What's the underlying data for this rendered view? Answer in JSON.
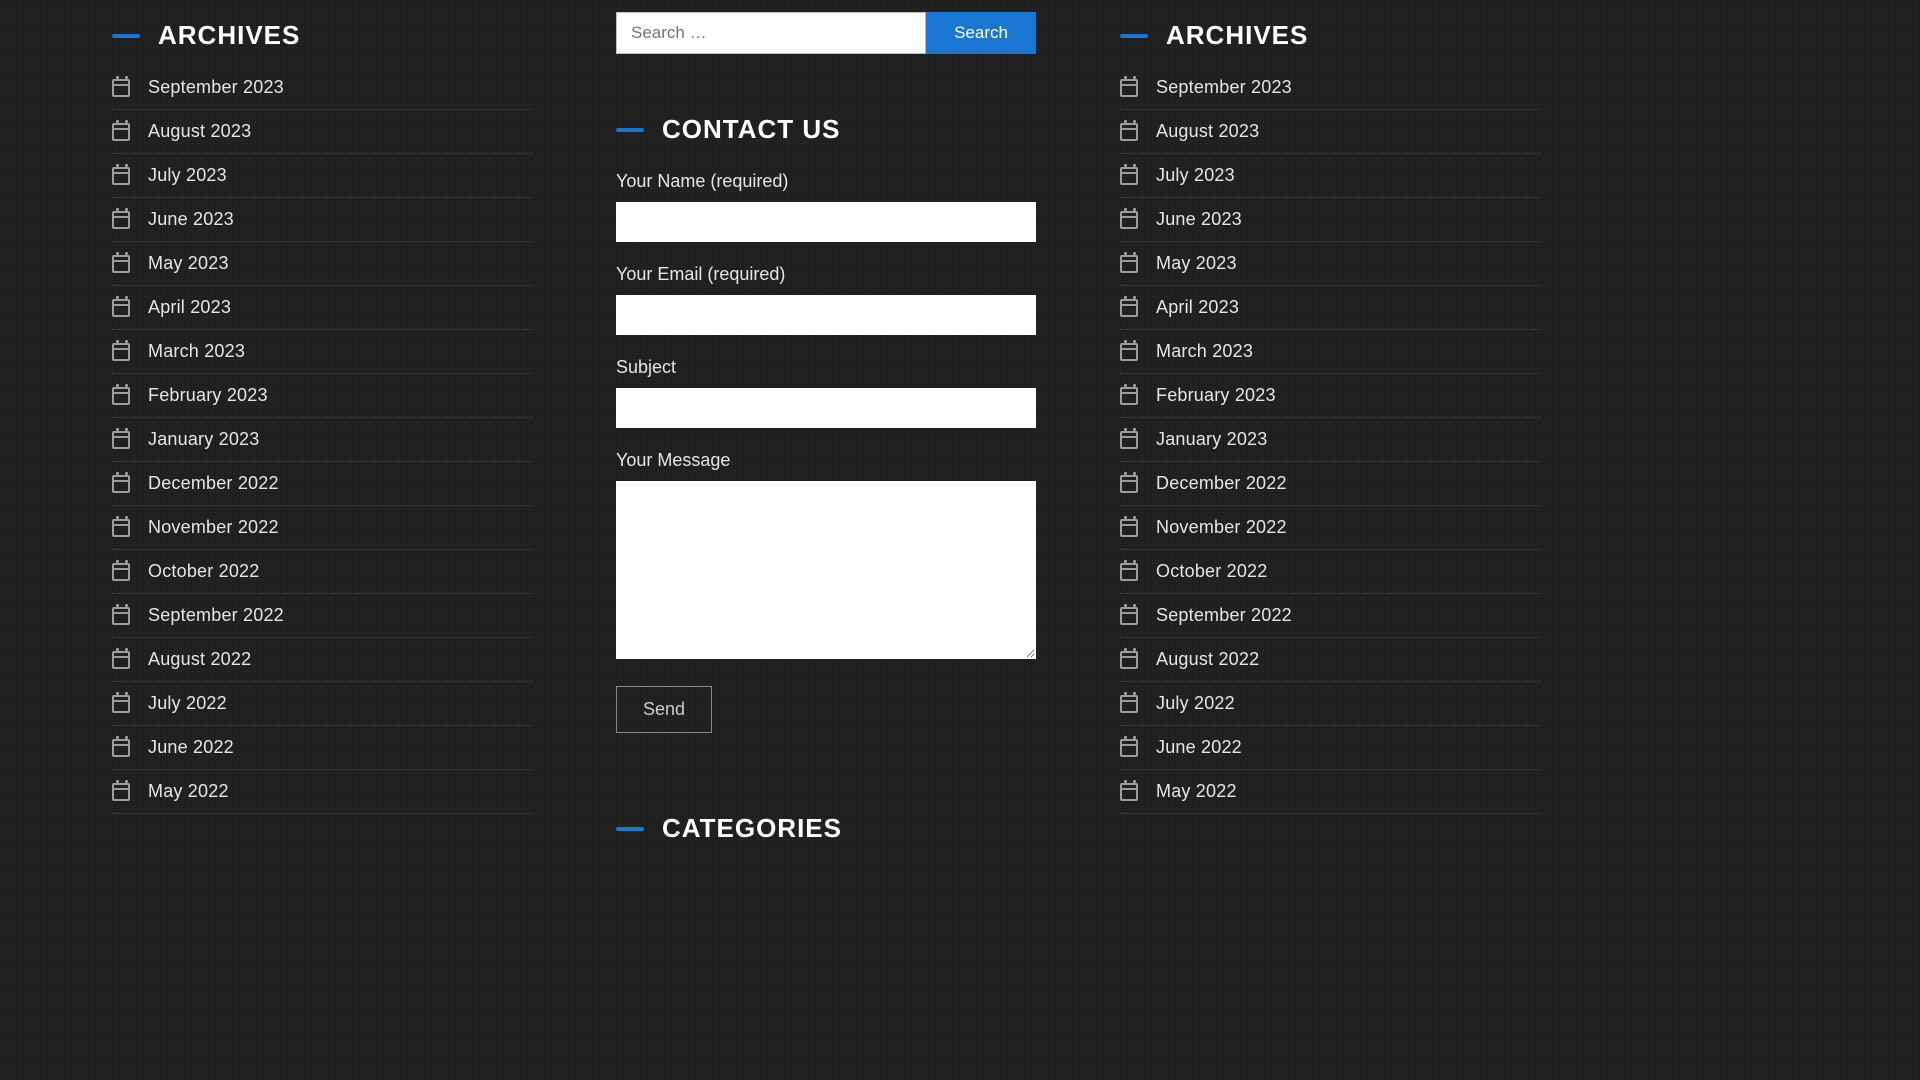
{
  "left": {
    "heading": "ARCHIVES",
    "items": [
      "September 2023",
      "August 2023",
      "July 2023",
      "June 2023",
      "May 2023",
      "April 2023",
      "March 2023",
      "February 2023",
      "January 2023",
      "December 2022",
      "November 2022",
      "October 2022",
      "September 2022",
      "August 2022",
      "July 2022",
      "June 2022",
      "May 2022"
    ]
  },
  "right": {
    "heading": "ARCHIVES",
    "items": [
      "September 2023",
      "August 2023",
      "July 2023",
      "June 2023",
      "May 2023",
      "April 2023",
      "March 2023",
      "February 2023",
      "January 2023",
      "December 2022",
      "November 2022",
      "October 2022",
      "September 2022",
      "August 2022",
      "July 2022",
      "June 2022",
      "May 2022"
    ]
  },
  "search": {
    "placeholder": "Search …",
    "button": "Search"
  },
  "contact": {
    "heading": "CONTACT US",
    "name_label": "Your Name (required)",
    "email_label": "Your Email (required)",
    "subject_label": "Subject",
    "message_label": "Your Message",
    "send_label": "Send"
  },
  "categories": {
    "heading": "CATEGORIES"
  }
}
